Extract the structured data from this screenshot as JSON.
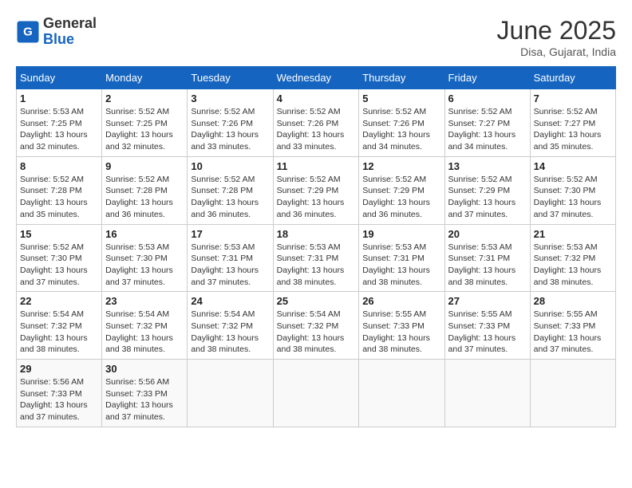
{
  "logo": {
    "general": "General",
    "blue": "Blue"
  },
  "title": "June 2025",
  "subtitle": "Disa, Gujarat, India",
  "days_header": [
    "Sunday",
    "Monday",
    "Tuesday",
    "Wednesday",
    "Thursday",
    "Friday",
    "Saturday"
  ],
  "weeks": [
    [
      {
        "day": "1",
        "info": "Sunrise: 5:53 AM\nSunset: 7:25 PM\nDaylight: 13 hours\nand 32 minutes."
      },
      {
        "day": "2",
        "info": "Sunrise: 5:52 AM\nSunset: 7:25 PM\nDaylight: 13 hours\nand 32 minutes."
      },
      {
        "day": "3",
        "info": "Sunrise: 5:52 AM\nSunset: 7:26 PM\nDaylight: 13 hours\nand 33 minutes."
      },
      {
        "day": "4",
        "info": "Sunrise: 5:52 AM\nSunset: 7:26 PM\nDaylight: 13 hours\nand 33 minutes."
      },
      {
        "day": "5",
        "info": "Sunrise: 5:52 AM\nSunset: 7:26 PM\nDaylight: 13 hours\nand 34 minutes."
      },
      {
        "day": "6",
        "info": "Sunrise: 5:52 AM\nSunset: 7:27 PM\nDaylight: 13 hours\nand 34 minutes."
      },
      {
        "day": "7",
        "info": "Sunrise: 5:52 AM\nSunset: 7:27 PM\nDaylight: 13 hours\nand 35 minutes."
      }
    ],
    [
      {
        "day": "8",
        "info": "Sunrise: 5:52 AM\nSunset: 7:28 PM\nDaylight: 13 hours\nand 35 minutes."
      },
      {
        "day": "9",
        "info": "Sunrise: 5:52 AM\nSunset: 7:28 PM\nDaylight: 13 hours\nand 36 minutes."
      },
      {
        "day": "10",
        "info": "Sunrise: 5:52 AM\nSunset: 7:28 PM\nDaylight: 13 hours\nand 36 minutes."
      },
      {
        "day": "11",
        "info": "Sunrise: 5:52 AM\nSunset: 7:29 PM\nDaylight: 13 hours\nand 36 minutes."
      },
      {
        "day": "12",
        "info": "Sunrise: 5:52 AM\nSunset: 7:29 PM\nDaylight: 13 hours\nand 36 minutes."
      },
      {
        "day": "13",
        "info": "Sunrise: 5:52 AM\nSunset: 7:29 PM\nDaylight: 13 hours\nand 37 minutes."
      },
      {
        "day": "14",
        "info": "Sunrise: 5:52 AM\nSunset: 7:30 PM\nDaylight: 13 hours\nand 37 minutes."
      }
    ],
    [
      {
        "day": "15",
        "info": "Sunrise: 5:52 AM\nSunset: 7:30 PM\nDaylight: 13 hours\nand 37 minutes."
      },
      {
        "day": "16",
        "info": "Sunrise: 5:53 AM\nSunset: 7:30 PM\nDaylight: 13 hours\nand 37 minutes."
      },
      {
        "day": "17",
        "info": "Sunrise: 5:53 AM\nSunset: 7:31 PM\nDaylight: 13 hours\nand 37 minutes."
      },
      {
        "day": "18",
        "info": "Sunrise: 5:53 AM\nSunset: 7:31 PM\nDaylight: 13 hours\nand 38 minutes."
      },
      {
        "day": "19",
        "info": "Sunrise: 5:53 AM\nSunset: 7:31 PM\nDaylight: 13 hours\nand 38 minutes."
      },
      {
        "day": "20",
        "info": "Sunrise: 5:53 AM\nSunset: 7:31 PM\nDaylight: 13 hours\nand 38 minutes."
      },
      {
        "day": "21",
        "info": "Sunrise: 5:53 AM\nSunset: 7:32 PM\nDaylight: 13 hours\nand 38 minutes."
      }
    ],
    [
      {
        "day": "22",
        "info": "Sunrise: 5:54 AM\nSunset: 7:32 PM\nDaylight: 13 hours\nand 38 minutes."
      },
      {
        "day": "23",
        "info": "Sunrise: 5:54 AM\nSunset: 7:32 PM\nDaylight: 13 hours\nand 38 minutes."
      },
      {
        "day": "24",
        "info": "Sunrise: 5:54 AM\nSunset: 7:32 PM\nDaylight: 13 hours\nand 38 minutes."
      },
      {
        "day": "25",
        "info": "Sunrise: 5:54 AM\nSunset: 7:32 PM\nDaylight: 13 hours\nand 38 minutes."
      },
      {
        "day": "26",
        "info": "Sunrise: 5:55 AM\nSunset: 7:33 PM\nDaylight: 13 hours\nand 38 minutes."
      },
      {
        "day": "27",
        "info": "Sunrise: 5:55 AM\nSunset: 7:33 PM\nDaylight: 13 hours\nand 37 minutes."
      },
      {
        "day": "28",
        "info": "Sunrise: 5:55 AM\nSunset: 7:33 PM\nDaylight: 13 hours\nand 37 minutes."
      }
    ],
    [
      {
        "day": "29",
        "info": "Sunrise: 5:56 AM\nSunset: 7:33 PM\nDaylight: 13 hours\nand 37 minutes."
      },
      {
        "day": "30",
        "info": "Sunrise: 5:56 AM\nSunset: 7:33 PM\nDaylight: 13 hours\nand 37 minutes."
      },
      null,
      null,
      null,
      null,
      null
    ]
  ]
}
